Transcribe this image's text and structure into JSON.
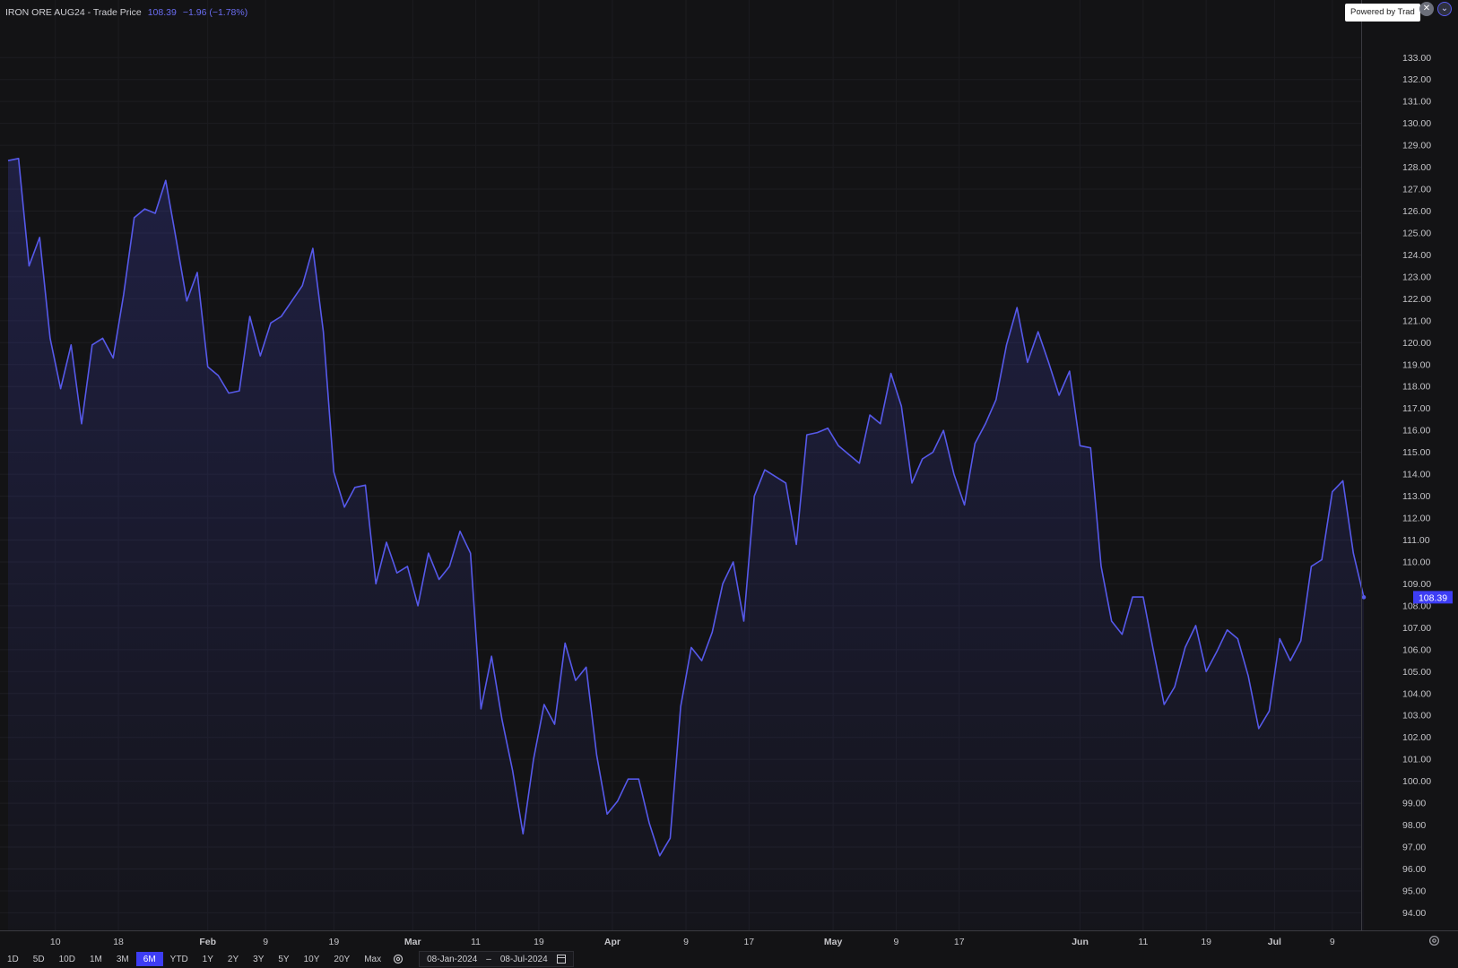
{
  "header": {
    "symbol": "IRON ORE AUG24 - Trade Price",
    "last": "108.39",
    "change": "−1.96 (−1.78%)"
  },
  "powered_by": "Powered by Trad",
  "icons": {
    "close": "close-icon",
    "collapse": "chevron-down-icon",
    "settings": "gear-icon",
    "calendar": "calendar-icon"
  },
  "colors": {
    "background": "#131315",
    "line": "#5659ea",
    "accent": "#3d3df5",
    "grid": "#1e1e22"
  },
  "toolbar": {
    "periods": [
      "1D",
      "5D",
      "10D",
      "1M",
      "3M",
      "6M",
      "YTD",
      "1Y",
      "2Y",
      "3Y",
      "5Y",
      "10Y",
      "20Y",
      "Max"
    ],
    "active_period": "6M",
    "date_from": "08-Jan-2024",
    "date_sep": "–",
    "date_to": "08-Jul-2024"
  },
  "chart_data": {
    "type": "area",
    "series": [
      {
        "values": [
          128.3,
          128.4,
          123.5,
          124.8,
          120.2,
          117.9,
          119.9,
          116.3,
          119.9,
          120.2,
          119.3,
          122.2,
          125.7,
          126.1,
          125.9,
          127.4,
          124.7,
          121.9,
          123.2,
          118.9,
          118.5,
          117.7,
          117.8,
          121.2,
          119.4,
          120.9,
          121.2,
          121.9,
          122.6,
          124.3,
          120.5,
          114.1,
          112.5,
          113.4,
          113.5,
          109.0,
          110.9,
          109.5,
          109.8,
          108.0,
          110.4,
          109.2,
          109.8,
          111.4,
          110.4,
          103.3,
          105.7,
          102.8,
          100.5,
          97.6,
          101.0,
          103.5,
          102.6,
          106.3,
          104.6,
          105.2,
          101.2,
          98.5,
          99.1,
          100.1,
          100.1,
          98.1,
          96.6,
          97.4,
          103.4,
          106.1,
          105.5,
          106.8,
          109.0,
          110.0,
          107.3,
          113.0,
          114.2,
          113.9,
          113.6,
          110.8,
          115.8,
          115.9,
          116.1,
          115.3,
          114.9,
          114.5,
          116.7,
          116.3,
          118.6,
          117.1,
          113.6,
          114.7,
          115.0,
          116.0,
          114.0,
          112.6,
          115.4,
          116.3,
          117.4,
          119.9,
          121.6,
          119.1,
          120.5,
          119.1,
          117.6,
          118.7,
          115.3,
          115.2,
          109.8,
          107.3,
          106.7,
          108.4,
          108.4,
          105.9,
          103.5,
          104.3,
          106.1,
          107.1,
          105.0,
          105.9,
          106.9,
          106.5,
          104.8,
          102.4,
          103.2,
          106.5,
          105.5,
          106.4,
          109.8,
          110.1,
          113.2,
          113.7,
          110.4,
          108.39
        ]
      }
    ],
    "x_tick_labels": [
      "10",
      "18",
      "Feb",
      "9",
      "19",
      "Mar",
      "11",
      "19",
      "Apr",
      "9",
      "17",
      "May",
      "9",
      "17",
      "Jun",
      "11",
      "19",
      "Jul",
      "9"
    ],
    "y_tick_labels": [
      "133.00",
      "132.00",
      "131.00",
      "130.00",
      "129.00",
      "128.00",
      "127.00",
      "126.00",
      "125.00",
      "124.00",
      "123.00",
      "122.00",
      "121.00",
      "120.00",
      "119.00",
      "118.00",
      "117.00",
      "116.00",
      "115.00",
      "114.00",
      "113.00",
      "112.00",
      "111.00",
      "110.00",
      "109.00",
      "108.00",
      "107.00",
      "106.00",
      "105.00",
      "104.00",
      "103.00",
      "102.00",
      "101.00",
      "100.00",
      "99.00",
      "98.00",
      "97.00",
      "96.00",
      "95.00",
      "94.00"
    ],
    "ylim": [
      93.2,
      134.4
    ],
    "last_value_label": "108.39",
    "grid": true
  }
}
